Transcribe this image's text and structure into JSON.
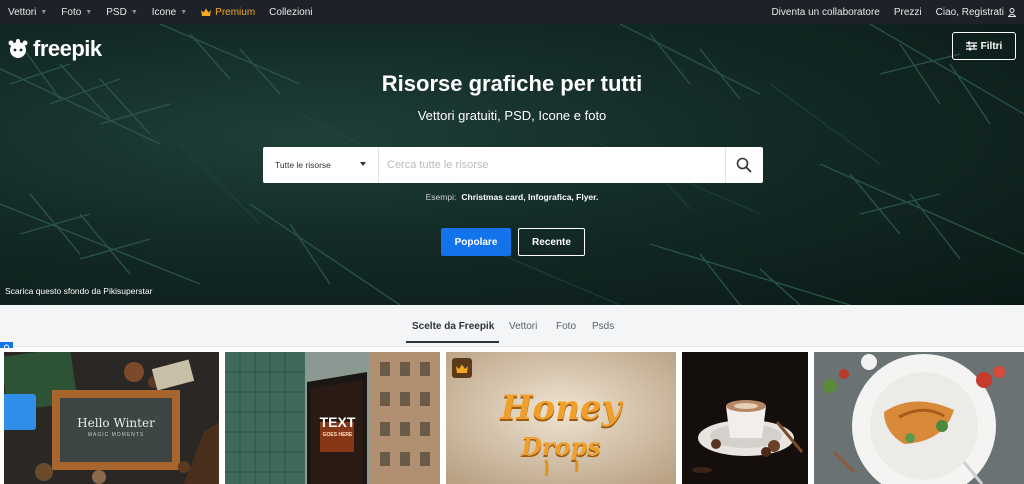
{
  "topnav": {
    "items": [
      {
        "label": "Vettori"
      },
      {
        "label": "Foto"
      },
      {
        "label": "PSD"
      },
      {
        "label": "Icone"
      }
    ],
    "premium_label": "Premium",
    "collections_label": "Collezioni",
    "right": {
      "contributor_label": "Diventa un collaboratore",
      "pricing_label": "Prezzi",
      "login_label": "Ciao, Registrati"
    }
  },
  "hero": {
    "logo_text": "freepik",
    "filters_label": "Filtri",
    "title": "Risorse grafiche per tutti",
    "subtitle": "Vettori gratuiti, PSD, Icone e foto",
    "search": {
      "category_label": "Tutte le risorse",
      "placeholder": "Cerca tutte le risorse"
    },
    "examples_label": "Esempi:",
    "examples_text": "Christmas card, Infografica, Flyer.",
    "popular_label": "Popolare",
    "recent_label": "Recente",
    "credit_text": "Scarica questo sfondo da Pikisuperstar"
  },
  "tabs": [
    {
      "label": "Scelte da Freepik"
    },
    {
      "label": "Vettori"
    },
    {
      "label": "Foto"
    },
    {
      "label": "Psds"
    }
  ],
  "cards": [
    {
      "name": "hello-winter",
      "text_line1": "Hello Winter",
      "text_line2": "MAGIC MOMENTS"
    },
    {
      "name": "city-billboard",
      "text_line1": "TEXT",
      "text_line2": "GOES HERE"
    },
    {
      "name": "honey-drops",
      "text_line1": "Honey",
      "text_line2": "Drops"
    },
    {
      "name": "coffee-cup"
    },
    {
      "name": "food-plate"
    }
  ],
  "colors": {
    "topnav_bg": "#1d2228",
    "accent_blue": "#1273eb",
    "premium_orange": "#f5a623",
    "hero_bg": "#132a26"
  }
}
